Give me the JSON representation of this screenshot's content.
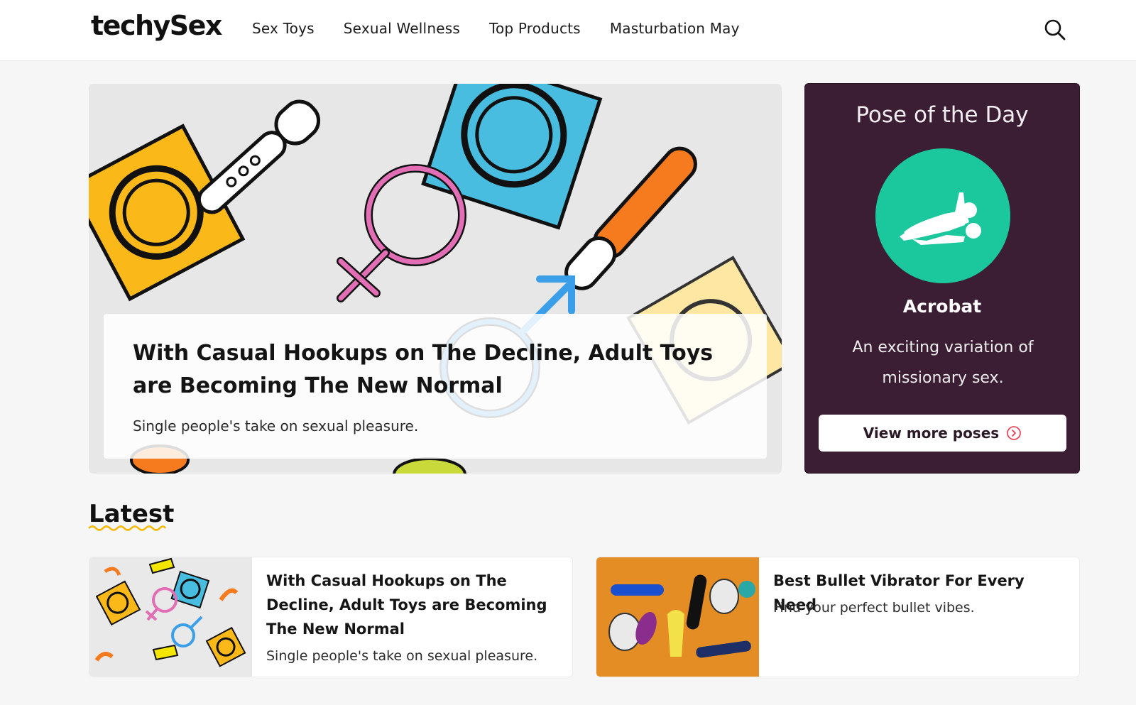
{
  "header": {
    "logo": "techySex",
    "nav": [
      "Sex Toys",
      "Sexual Wellness",
      "Top Products",
      "Masturbation May"
    ],
    "search_icon": "search-icon"
  },
  "hero": {
    "title": "With Casual Hookups on The Decline, Adult Toys are Becoming The New Normal",
    "subtitle": "Single people's take on sexual pleasure."
  },
  "pose_of_day": {
    "heading": "Pose of the Day",
    "name": "Acrobat",
    "description": "An exciting variation of missionary sex.",
    "button_label": "View more poses",
    "button_icon": "arrow-right-circle-icon",
    "accent": "#1bc79c",
    "background": "#3b1e33"
  },
  "latest": {
    "heading": "Latest",
    "items": [
      {
        "title": "With Casual Hookups on The Decline, Adult Toys are Becoming The New Normal",
        "subtitle": "Single people's take on sexual pleasure."
      },
      {
        "title": "Best Bullet Vibrator For Every Need",
        "subtitle": "Find your perfect bullet vibes."
      }
    ]
  },
  "colors": {
    "brand_dark": "#3b1e33",
    "teal": "#1bc79c",
    "squiggle": "#f5b800",
    "arrow_accent": "#e8334a"
  }
}
